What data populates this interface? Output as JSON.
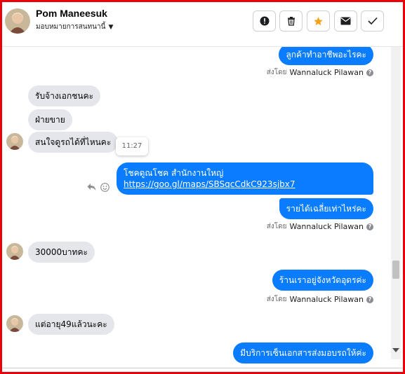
{
  "header": {
    "contact_name": "Pom Maneesuk",
    "assign_label": "มอบหมายการสนทนานี้",
    "buttons": [
      {
        "icon": "alert-circle-icon"
      },
      {
        "icon": "trash-icon"
      },
      {
        "icon": "star-icon"
      },
      {
        "icon": "envelope-icon"
      },
      {
        "icon": "checkmark-icon"
      }
    ]
  },
  "colors": {
    "accent": "#0a7cff",
    "incoming_bubble": "#e4e6eb",
    "star": "#f7a21b",
    "frame": "#e8000b"
  },
  "messages": {
    "m1": "ลูกค้าทำอาชีพอะไรคะ",
    "m2": "รับจ้างเอกชนคะ",
    "m3": "ฝ่ายขาย",
    "m4": "สนใจดูรถได้ที่ไหนคะ",
    "m5_line1": "โชคดูณโชค สำนักงานใหญ่",
    "m5_link": "https://goo.gl/maps/SBSqcCdkC923sjbx7",
    "m6": "รายได้เฉลี่ยเท่าไหร่คะ",
    "m7": "30000บาทคะ",
    "m8": "ร้านเราอยู่จังหวัดอุดรค่ะ",
    "m9": "แต่อายุ49แล้วนะคะ",
    "m10": "มีบริการเซ็นเอกสารส่งมอบรถให้ค่ะ"
  },
  "sent_by": {
    "prefix": "ส่งโดย",
    "agent": "Wannaluck Pilawan"
  },
  "tooltip_time": "11:27"
}
